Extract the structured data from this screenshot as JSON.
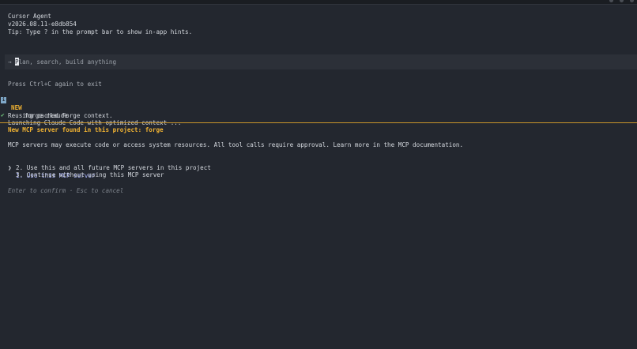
{
  "header": {
    "app_name": "Cursor Agent",
    "version": "v2026.08.11-e8db854",
    "tip": "Tip: Type ? in the prompt bar to show in-app hints."
  },
  "prompt": {
    "arrow": "→",
    "first_char": "P",
    "placeholder_rest": "lan, search, build anything"
  },
  "log": {
    "exit_hint": "Press Ctrl+C again to exit",
    "new_badge": "NEW",
    "new_item": "forge claude",
    "reusing": "Reusing cached Forge context.",
    "launching": "Launching Claude Code with optimized context ..."
  },
  "mcp": {
    "title": "New MCP server found in this project: forge",
    "description": "MCP servers may execute code or access system resources. All tool calls require approval. Learn more in the MCP documentation.",
    "caret": "❯",
    "options": [
      "1. Use this MCP server",
      "2. Use this and all future MCP servers in this project",
      "3. Continue without using this MCP server"
    ],
    "footer_hint": "Enter to confirm · Esc to cancel"
  }
}
